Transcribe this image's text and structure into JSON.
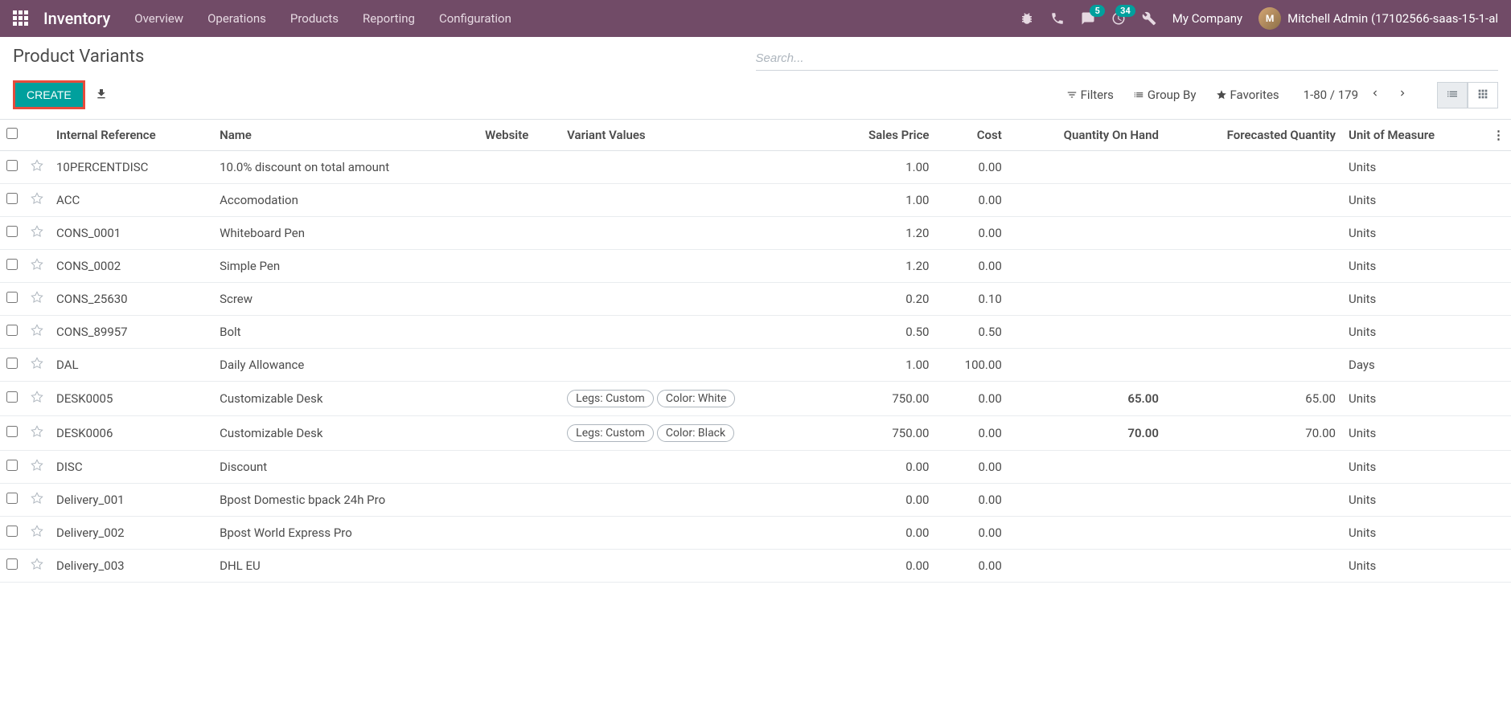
{
  "navbar": {
    "brand": "Inventory",
    "menu": [
      "Overview",
      "Operations",
      "Products",
      "Reporting",
      "Configuration"
    ],
    "messages_badge": "5",
    "activities_badge": "34",
    "company": "My Company",
    "user": "Mitchell Admin (17102566-saas-15-1-al"
  },
  "page": {
    "title": "Product Variants",
    "search_placeholder": "Search...",
    "create_label": "CREATE",
    "filters_label": "Filters",
    "groupby_label": "Group By",
    "favorites_label": "Favorites",
    "pager": "1-80 / 179"
  },
  "table": {
    "headers": {
      "internal_ref": "Internal Reference",
      "name": "Name",
      "website": "Website",
      "variant_values": "Variant Values",
      "sales_price": "Sales Price",
      "cost": "Cost",
      "qty_on_hand": "Quantity On Hand",
      "forecasted": "Forecasted Quantity",
      "uom": "Unit of Measure"
    },
    "rows": [
      {
        "ref": "10PERCENTDISC",
        "name": "10.0% discount on total amount",
        "variants": [],
        "price": "1.00",
        "cost": "0.00",
        "qty": "",
        "fq": "",
        "uom": "Units"
      },
      {
        "ref": "ACC",
        "name": "Accomodation",
        "variants": [],
        "price": "1.00",
        "cost": "0.00",
        "qty": "",
        "fq": "",
        "uom": "Units"
      },
      {
        "ref": "CONS_0001",
        "name": "Whiteboard Pen",
        "variants": [],
        "price": "1.20",
        "cost": "0.00",
        "qty": "",
        "fq": "",
        "uom": "Units"
      },
      {
        "ref": "CONS_0002",
        "name": "Simple Pen",
        "variants": [],
        "price": "1.20",
        "cost": "0.00",
        "qty": "",
        "fq": "",
        "uom": "Units"
      },
      {
        "ref": "CONS_25630",
        "name": "Screw",
        "variants": [],
        "price": "0.20",
        "cost": "0.10",
        "qty": "",
        "fq": "",
        "uom": "Units"
      },
      {
        "ref": "CONS_89957",
        "name": "Bolt",
        "variants": [],
        "price": "0.50",
        "cost": "0.50",
        "qty": "",
        "fq": "",
        "uom": "Units"
      },
      {
        "ref": "DAL",
        "name": "Daily Allowance",
        "variants": [],
        "price": "1.00",
        "cost": "100.00",
        "qty": "",
        "fq": "",
        "uom": "Days"
      },
      {
        "ref": "DESK0005",
        "name": "Customizable Desk",
        "variants": [
          "Legs: Custom",
          "Color: White"
        ],
        "price": "750.00",
        "cost": "0.00",
        "qty": "65.00",
        "fq": "65.00",
        "uom": "Units",
        "bold": true
      },
      {
        "ref": "DESK0006",
        "name": "Customizable Desk",
        "variants": [
          "Legs: Custom",
          "Color: Black"
        ],
        "price": "750.00",
        "cost": "0.00",
        "qty": "70.00",
        "fq": "70.00",
        "uom": "Units",
        "bold": true
      },
      {
        "ref": "DISC",
        "name": "Discount",
        "variants": [],
        "price": "0.00",
        "cost": "0.00",
        "qty": "",
        "fq": "",
        "uom": "Units"
      },
      {
        "ref": "Delivery_001",
        "name": "Bpost Domestic bpack 24h Pro",
        "variants": [],
        "price": "0.00",
        "cost": "0.00",
        "qty": "",
        "fq": "",
        "uom": "Units"
      },
      {
        "ref": "Delivery_002",
        "name": "Bpost World Express Pro",
        "variants": [],
        "price": "0.00",
        "cost": "0.00",
        "qty": "",
        "fq": "",
        "uom": "Units"
      },
      {
        "ref": "Delivery_003",
        "name": "DHL EU",
        "variants": [],
        "price": "0.00",
        "cost": "0.00",
        "qty": "",
        "fq": "",
        "uom": "Units"
      }
    ]
  }
}
